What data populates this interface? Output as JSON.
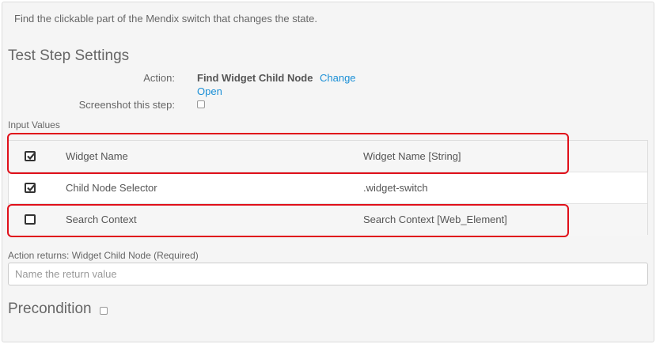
{
  "description": "Find the clickable part of the Mendix switch that changes the state.",
  "settings": {
    "title": "Test Step Settings",
    "action_label": "Action:",
    "action_value": "Find Widget Child Node",
    "change_link": "Change",
    "open_link": "Open",
    "screenshot_label": "Screenshot this step:",
    "screenshot_checked": false
  },
  "input_values": {
    "label": "Input Values",
    "rows": [
      {
        "name": "Widget Name",
        "value": "Widget Name [String]",
        "checked": true,
        "highlighted": true
      },
      {
        "name": "Child Node Selector",
        "value": ".widget-switch",
        "checked": true,
        "highlighted": false
      },
      {
        "name": "Search Context",
        "value": "Search Context [Web_Element]",
        "checked": false,
        "highlighted": true
      }
    ]
  },
  "returns": {
    "label": "Action returns: Widget Child Node (Required)",
    "placeholder": "Name the return value"
  },
  "precondition": {
    "title": "Precondition",
    "checked": false
  },
  "colors": {
    "link": "#1a8fd6",
    "highlight": "#e0101a",
    "background": "#f5f5f5"
  }
}
